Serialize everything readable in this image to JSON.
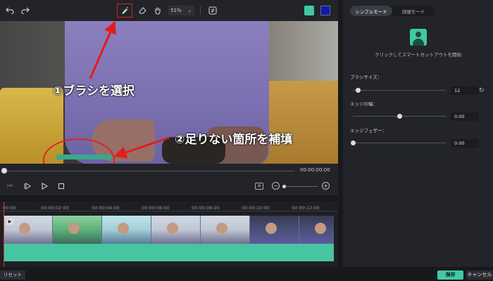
{
  "toolbar": {
    "zoom_value": "51%",
    "icons": [
      "undo-icon",
      "redo-icon",
      "smart-brush-icon",
      "eraser-icon",
      "hand-icon",
      "compare-icon",
      "person-icon"
    ],
    "brush_color": "#0e1aa8"
  },
  "annotations": {
    "step1": "①ブラシを選択",
    "step2": "②足りない箇所を補填"
  },
  "player": {
    "timecode": "00:00:00:00"
  },
  "timeline": {
    "ruler": [
      "00:00",
      "00:00:02:00",
      "00:00:04:00",
      "00:00:06:00",
      "00:00:08:00",
      "00:00:10:00",
      "00:00:12:00"
    ]
  },
  "panel": {
    "tabs": [
      "シンプルモード",
      "詳細モード"
    ],
    "active_tab": "シンプルモード",
    "smart_cutout_label": "クリックしてスマートカットアウトを開始",
    "brush_size": {
      "label": "ブラシサイズ：",
      "value": "12",
      "level": 0.05
    },
    "edge_width": {
      "label": "エッジの幅：",
      "value": "0.00",
      "level": 0.5
    },
    "edge_feather": {
      "label": "エッジフェザー：",
      "value": "0.00",
      "level": 0.0
    }
  },
  "footer": {
    "reset_label": "リセット",
    "save_label": "保存",
    "cancel_label": "キャンセル"
  },
  "colors": {
    "accent": "#40c9a2",
    "annotation_red": "#e11d1d"
  }
}
